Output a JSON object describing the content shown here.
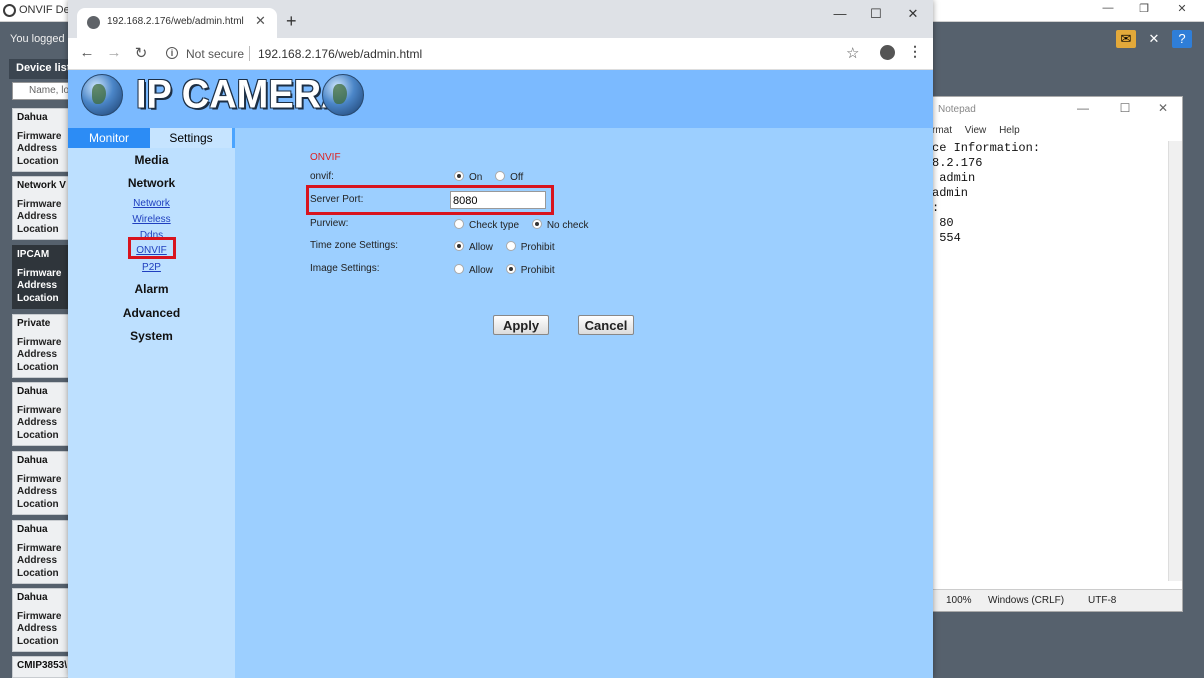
{
  "odm": {
    "title": "ONVIF Devi",
    "logged_in": "You logged i",
    "devlist_header": "Device list",
    "search_placeholder": "Name, lo",
    "devices": [
      {
        "name": "Dahua",
        "firmware": "Firmware",
        "address": "Address",
        "location": "Location",
        "selected": false
      },
      {
        "name": "Network V",
        "firmware": "Firmware",
        "address": "Address",
        "location": "Location",
        "selected": false
      },
      {
        "name": "IPCAM",
        "firmware": "Firmware",
        "address": "Address",
        "location": "Location",
        "selected": true
      },
      {
        "name": "Private",
        "firmware": "Firmware",
        "address": "Address",
        "location": "Location",
        "selected": false
      },
      {
        "name": "Dahua",
        "firmware": "Firmware",
        "address": "Address",
        "location": "Location",
        "selected": false
      },
      {
        "name": "Dahua",
        "firmware": "Firmware",
        "address": "Address",
        "location": "Location",
        "selected": false
      },
      {
        "name": "Dahua",
        "firmware": "Firmware",
        "address": "Address",
        "location": "Location",
        "selected": false
      },
      {
        "name": "Dahua",
        "firmware": "Firmware",
        "address": "Address",
        "location": "Location",
        "selected": false
      },
      {
        "name": "CMIP3853\\",
        "firmware": "",
        "address": "",
        "location": "",
        "selected": false
      }
    ],
    "window_buttons": {
      "minimize": "—",
      "restore": "❐",
      "close": "✕"
    }
  },
  "notepad": {
    "title": "Notepad",
    "menu": [
      "rmat",
      "View",
      "Help"
    ],
    "lines": [
      "ce Information:",
      "8.2.176",
      " admin",
      "admin",
      ":",
      " 80",
      " 554"
    ],
    "status": {
      "zoom": "100%",
      "eol": "Windows (CRLF)",
      "encoding": "UTF-8"
    },
    "window_buttons": {
      "minimize": "—",
      "maximize": "☐",
      "close": "✕"
    }
  },
  "browser": {
    "tab_title": "192.168.2.176/web/admin.html",
    "tab_close": "✕",
    "new_tab": "+",
    "window_buttons": {
      "minimize": "—",
      "maximize": "☐",
      "close": "✕"
    },
    "nav": {
      "back": "←",
      "forward": "→",
      "reload": "↻"
    },
    "security_label": "Not secure",
    "url": "192.168.2.176/web/admin.html",
    "star": "☆",
    "menu": "⋮"
  },
  "page": {
    "brand": "IP CAMERA",
    "tabs": {
      "monitor": "Monitor",
      "settings": "Settings"
    },
    "menu": {
      "media": "Media",
      "network": "Network",
      "sub_network": "Network",
      "sub_wireless": "Wireless",
      "sub_ddns": "Ddns",
      "sub_onvif": "ONVIF",
      "sub_p2p": "P2P",
      "alarm": "Alarm",
      "advanced": "Advanced",
      "system": "System"
    },
    "form": {
      "section_title": "ONVIF",
      "onvif_label": "onvif:",
      "onvif_on": "On",
      "onvif_off": "Off",
      "onvif_value": "On",
      "port_label": "Server Port:",
      "port_value": "8080",
      "purview_label": "Purview:",
      "purview_opt1": "Check type",
      "purview_opt2": "No check",
      "purview_value": "No check",
      "timezone_label": "Time zone Settings:",
      "timezone_opt1": "Allow",
      "timezone_opt2": "Prohibit",
      "timezone_value": "Allow",
      "image_label": "Image Settings:",
      "image_opt1": "Allow",
      "image_opt2": "Prohibit",
      "image_value": "Prohibit",
      "apply": "Apply",
      "cancel": "Cancel"
    }
  },
  "colors": {
    "highlight": "#d8141e",
    "page_bg": "#9ccfff",
    "banner": "#7bbaff",
    "section_title": "#dd2222"
  }
}
